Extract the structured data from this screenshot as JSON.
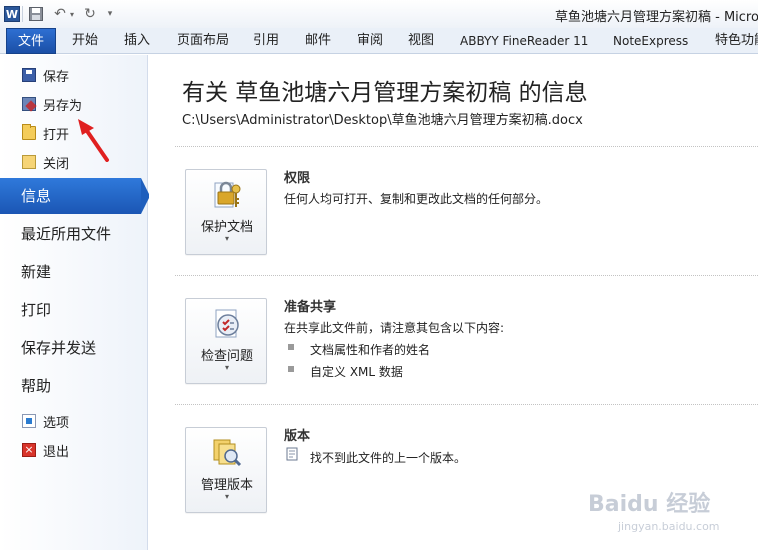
{
  "app": {
    "window_title": "草鱼池塘六月管理方案初稿  -  Microso",
    "app_icon_letter": "W"
  },
  "ribbon": {
    "tabs": [
      "文件",
      "开始",
      "插入",
      "页面布局",
      "引用",
      "邮件",
      "审阅",
      "视图",
      "ABBYY FineReader 11",
      "NoteExpress",
      "特色功能"
    ]
  },
  "backstage": {
    "commands_top": [
      {
        "label": "保存",
        "icon": "save-icon"
      },
      {
        "label": "另存为",
        "icon": "save-as-icon"
      },
      {
        "label": "打开",
        "icon": "open-folder-icon"
      },
      {
        "label": "关闭",
        "icon": "close-folder-icon"
      }
    ],
    "tabs": [
      "信息",
      "最近所用文件",
      "新建",
      "打印",
      "保存并发送",
      "帮助"
    ],
    "selected_tab": "信息",
    "commands_bottom": [
      {
        "label": "选项",
        "icon": "options-icon"
      },
      {
        "label": "退出",
        "icon": "exit-icon"
      }
    ]
  },
  "info": {
    "title": "有关 草鱼池塘六月管理方案初稿 的信息",
    "path": "C:\\Users\\Administrator\\Desktop\\草鱼池塘六月管理方案初稿.docx",
    "sections": [
      {
        "button_label": "保护文档",
        "icon": "lock-keys-icon",
        "title": "权限",
        "text": "任何人均可打开、复制和更改此文档的任何部分。",
        "bullets": []
      },
      {
        "button_label": "检查问题",
        "icon": "inspect-checklist-icon",
        "title": "准备共享",
        "text": "在共享此文件前，请注意其包含以下内容:",
        "bullets": [
          "文档属性和作者的姓名",
          "自定义 XML 数据"
        ]
      },
      {
        "button_label": "管理版本",
        "icon": "versions-icon",
        "title": "版本",
        "text": "找不到此文件的上一个版本。",
        "bullets": []
      }
    ]
  },
  "watermark": {
    "main": "Baidu 经验",
    "sub": "jingyan.baidu.com"
  },
  "colors": {
    "accent": "#1f5fbd",
    "annotation_arrow": "#e02020"
  }
}
